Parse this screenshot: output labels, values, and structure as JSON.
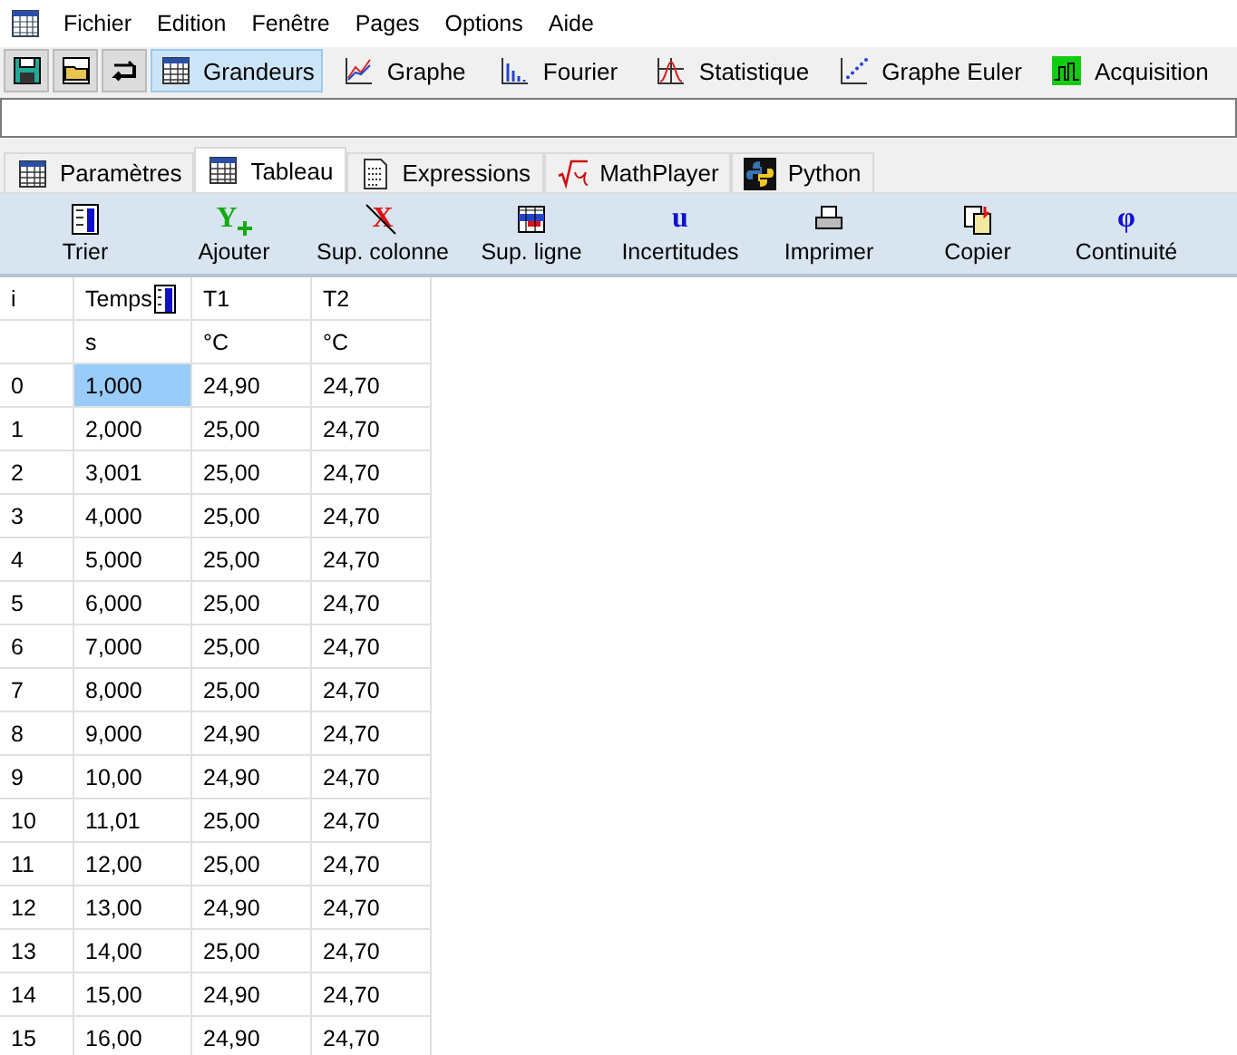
{
  "menu": [
    "Fichier",
    "Edition",
    "Fenêtre",
    "Pages",
    "Options",
    "Aide"
  ],
  "toolbar": [
    {
      "kind": "save",
      "selected": false
    },
    {
      "kind": "open",
      "selected": false
    },
    {
      "kind": "swap",
      "selected": false
    },
    {
      "kind": "table",
      "label": "Grandeurs",
      "selected": true
    },
    {
      "kind": "graph",
      "label": "Graphe",
      "selected": false
    },
    {
      "kind": "fourier",
      "label": "Fourier",
      "selected": false
    },
    {
      "kind": "stats",
      "label": "Statistique",
      "selected": false
    },
    {
      "kind": "euler",
      "label": "Graphe Euler",
      "selected": false
    },
    {
      "kind": "acq",
      "label": "Acquisition",
      "selected": false
    }
  ],
  "tabs": [
    {
      "kind": "table",
      "label": "Paramètres",
      "selected": false
    },
    {
      "kind": "table",
      "label": "Tableau",
      "selected": true
    },
    {
      "kind": "doc",
      "label": "Expressions",
      "selected": false
    },
    {
      "kind": "sqrt",
      "label": "MathPlayer",
      "selected": false
    },
    {
      "kind": "python",
      "label": "Python",
      "selected": false
    }
  ],
  "actions": [
    {
      "kind": "sort",
      "label": "Trier"
    },
    {
      "kind": "add",
      "glyph": "Y",
      "label": "Ajouter"
    },
    {
      "kind": "delcol",
      "glyph": "X",
      "label": "Sup. colonne"
    },
    {
      "kind": "delrow",
      "label": "Sup. ligne"
    },
    {
      "kind": "glyph",
      "glyph": "u",
      "label": "Incertitudes"
    },
    {
      "kind": "print",
      "label": "Imprimer"
    },
    {
      "kind": "copy",
      "label": "Copier"
    },
    {
      "kind": "glyph",
      "glyph": "φ",
      "label": "Continuité"
    }
  ],
  "table": {
    "columns": [
      "i",
      "Temps",
      "T1",
      "T2"
    ],
    "units": [
      "s",
      "°C",
      "°C"
    ],
    "rows": [
      {
        "cells": [
          "0",
          "1,000",
          "24,90",
          "24,70"
        ],
        "selected": true
      },
      {
        "cells": [
          "1",
          "2,000",
          "25,00",
          "24,70"
        ],
        "selected": false
      },
      {
        "cells": [
          "2",
          "3,001",
          "25,00",
          "24,70"
        ],
        "selected": false
      },
      {
        "cells": [
          "3",
          "4,000",
          "25,00",
          "24,70"
        ],
        "selected": false
      },
      {
        "cells": [
          "4",
          "5,000",
          "25,00",
          "24,70"
        ],
        "selected": false
      },
      {
        "cells": [
          "5",
          "6,000",
          "25,00",
          "24,70"
        ],
        "selected": false
      },
      {
        "cells": [
          "6",
          "7,000",
          "25,00",
          "24,70"
        ],
        "selected": false
      },
      {
        "cells": [
          "7",
          "8,000",
          "25,00",
          "24,70"
        ],
        "selected": false
      },
      {
        "cells": [
          "8",
          "9,000",
          "24,90",
          "24,70"
        ],
        "selected": false
      },
      {
        "cells": [
          "9",
          "10,00",
          "24,90",
          "24,70"
        ],
        "selected": false
      },
      {
        "cells": [
          "10",
          "11,01",
          "25,00",
          "24,70"
        ],
        "selected": false
      },
      {
        "cells": [
          "11",
          "12,00",
          "25,00",
          "24,70"
        ],
        "selected": false
      },
      {
        "cells": [
          "12",
          "13,00",
          "24,90",
          "24,70"
        ],
        "selected": false
      },
      {
        "cells": [
          "13",
          "14,00",
          "25,00",
          "24,70"
        ],
        "selected": false
      },
      {
        "cells": [
          "14",
          "15,00",
          "24,90",
          "24,70"
        ],
        "selected": false
      },
      {
        "cells": [
          "15",
          "16,00",
          "24,90",
          "24,70"
        ],
        "selected": false
      }
    ]
  }
}
